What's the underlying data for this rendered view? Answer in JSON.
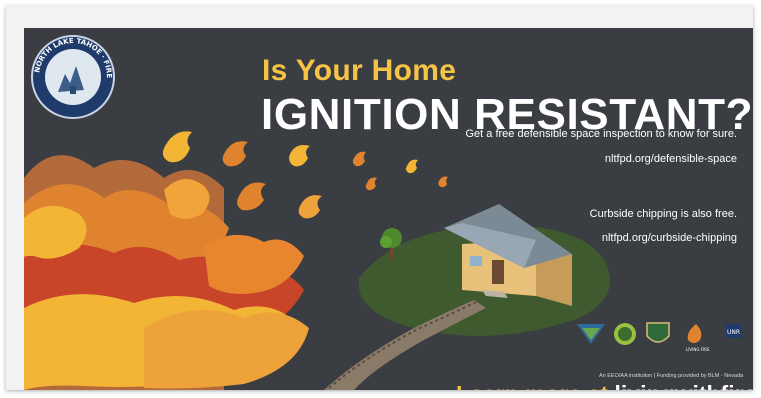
{
  "headline": {
    "line1": "Is Your Home",
    "line2": "IGNITION RESISTANT?"
  },
  "body_copy": {
    "inspection_text": "Get a free defensible space inspection to know for sure.",
    "inspection_url": "nltfpd.org/defensible-space",
    "chipping_text": "Curbside chipping is also free.",
    "chipping_url": "nltfpd.org/curbside-chipping"
  },
  "footer": {
    "eeo_text": "An EEO/AA institution | Funding provided by BLM - Nevada",
    "cta_prefix": "Learn more at ",
    "cta_site": "livingwithfire.com"
  },
  "seal": {
    "text": "NORTH LAKE TAHOE · FIRE DISTRICT"
  },
  "logos": [
    "blm-logo",
    "forest-logo",
    "usfs-shield-logo",
    "living-with-fire-logo",
    "extension-logo"
  ],
  "colors": {
    "background": "#3a3d42",
    "accent_yellow": "#f6c445",
    "text_white": "#ffffff",
    "flame_orange": "#e07a2b",
    "flame_red": "#c9452a",
    "flame_yellow": "#f3b535"
  }
}
